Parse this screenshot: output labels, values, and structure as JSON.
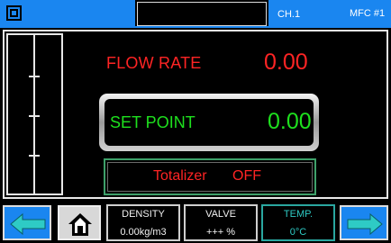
{
  "header": {
    "channel": "CH.1",
    "device": "MFC #1"
  },
  "main": {
    "flow_rate": {
      "label": "FLOW RATE",
      "value": "0.00"
    },
    "set_point": {
      "label": "SET POINT",
      "value": "0.00"
    },
    "totalizer": {
      "label": "Totalizer",
      "state": "OFF"
    }
  },
  "footer": {
    "density": {
      "title": "DENSITY",
      "value": "0.00kg/m3"
    },
    "valve": {
      "title": "VALVE",
      "value": "+++ %"
    },
    "temp": {
      "title": "TEMP.",
      "value": "0°C"
    }
  },
  "colors": {
    "accent": "#1a86f0",
    "measured": "#ff2424",
    "setpoint": "#1ee01e",
    "temp": "#2ecbc5"
  },
  "icons": {
    "menu": "menu-icon",
    "home": "home-icon",
    "back": "arrow-left-icon",
    "forward": "arrow-right-icon"
  }
}
